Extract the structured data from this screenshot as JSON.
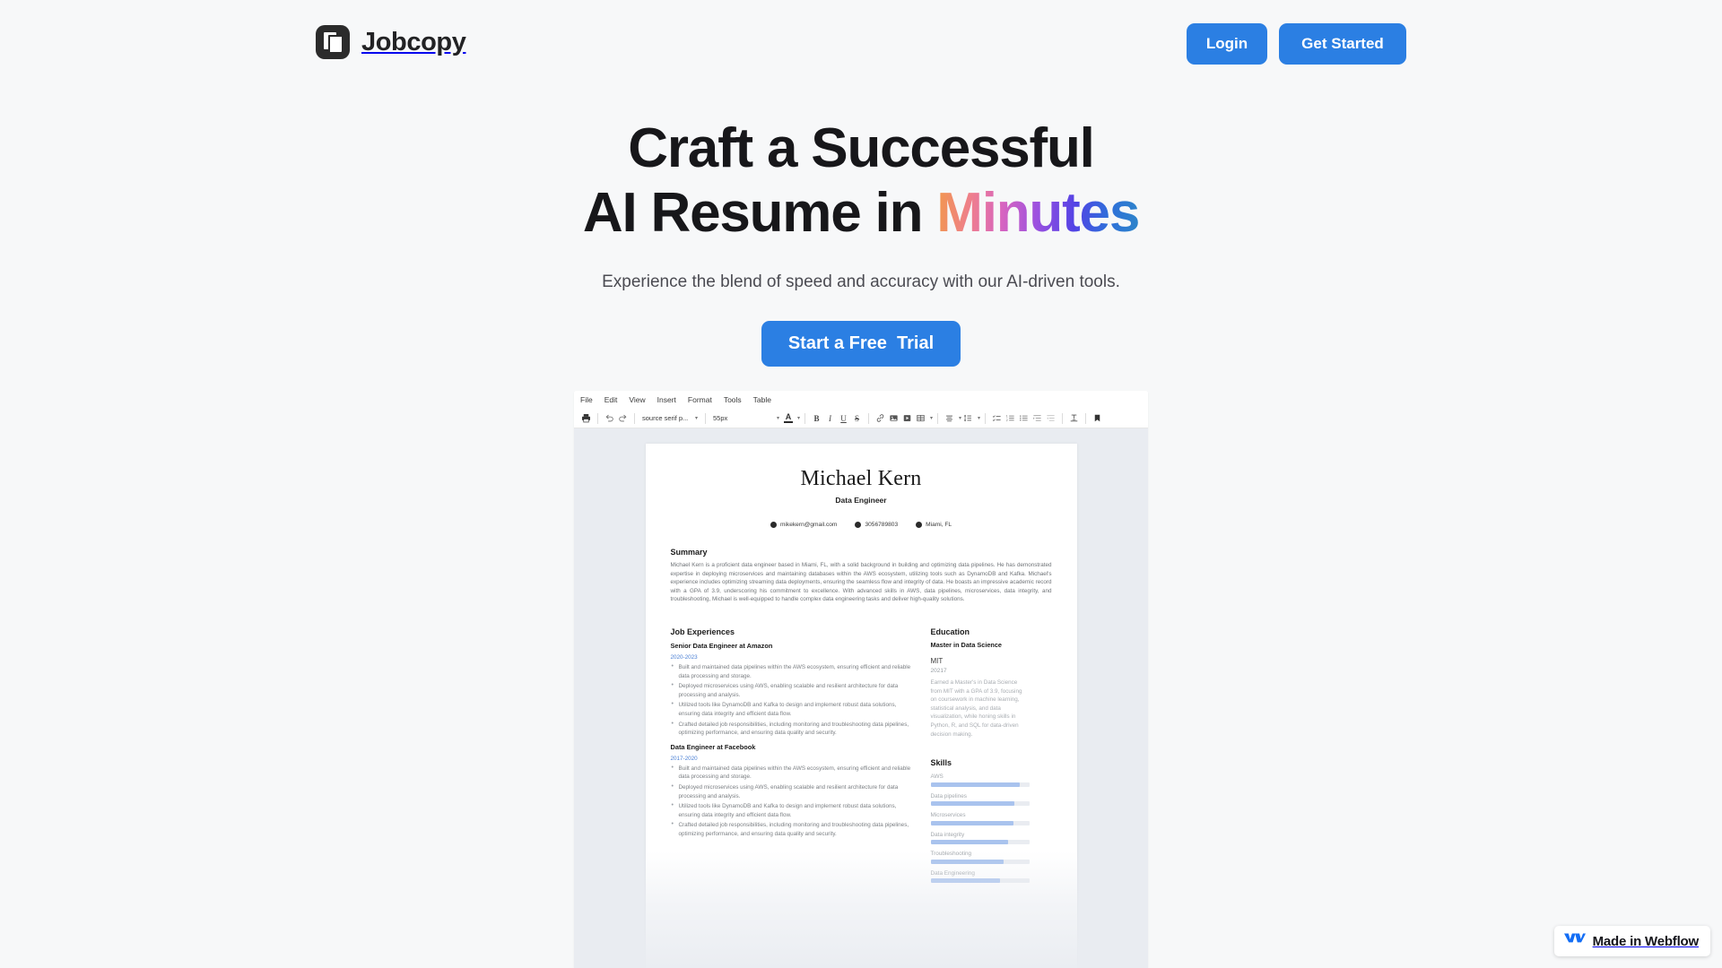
{
  "header": {
    "brand_name": "Jobcopy",
    "login_label": "Login",
    "get_started_label": "Get Started"
  },
  "hero": {
    "headline_line1": "Craft a Successful",
    "headline_line2_prefix": "AI Resume in ",
    "headline_gradient_word": "Minutes",
    "subtitle": "Experience the blend of speed and accuracy with our AI-driven tools.",
    "cta_label": "Start a Free  Trial",
    "gradient_colors": [
      "#F2994A",
      "#EE7E8F",
      "#D764C0",
      "#9B51E0",
      "#5243E5",
      "#2F6FDA",
      "#2D86C9"
    ],
    "accent_color": "#2B7FE3"
  },
  "editor": {
    "menu": [
      "File",
      "Edit",
      "View",
      "Insert",
      "Format",
      "Tools",
      "Table"
    ],
    "toolbar": {
      "print": "print-icon",
      "undo": "undo-icon",
      "redo": "redo-icon",
      "font_family_value": "source serif p...",
      "font_size_value": "55px",
      "text_color": "A",
      "bold": "B",
      "italic": "I",
      "underline": "U",
      "strikethrough": "S",
      "link": "link-icon",
      "image": "image-icon",
      "video": "video-icon",
      "table": "table-icon",
      "align": "align-icon",
      "line_height": "line-height-icon",
      "checklist": "checklist-icon",
      "bullet_list": "bullet-list-icon",
      "numbered_list": "numbered-list-icon",
      "indent_increase": "indent-increase-icon",
      "indent_decrease": "indent-decrease-icon",
      "clear_format": "clear-format-icon",
      "bookmark": "bookmark-icon"
    }
  },
  "resume": {
    "name": "Michael Kern",
    "role": "Data Engineer",
    "contacts": [
      {
        "icon": "email-icon",
        "value": "mikekern@gmail.com"
      },
      {
        "icon": "phone-icon",
        "value": "3056789803"
      },
      {
        "icon": "location-icon",
        "value": "Miami, FL"
      }
    ],
    "summary_title": "Summary",
    "summary_text": "Michael Kern is a proficient data engineer based in Miami, FL, with a solid background in building and optimizing data pipelines. He has demonstrated expertise in deploying microservices and maintaining databases within the AWS ecosystem, utilizing tools such as DynamoDB and Kafka. Michael's experience includes optimizing streaming data deployments, ensuring the seamless flow and integrity of data. He boasts an impressive academic record with a GPA of 3.9, underscoring his commitment to excellence. With advanced skills in AWS, data pipelines, microservices, data integrity, and troubleshooting, Michael is well-equipped to handle complex data engineering tasks and deliver high-quality solutions.",
    "jobs_title": "Job Experiences",
    "jobs": [
      {
        "title": "Senior Data Engineer at Amazon",
        "dates": "2020-2023",
        "bullets": [
          "Built and maintained data pipelines within the AWS ecosystem, ensuring efficient and reliable data processing and storage.",
          "Deployed microservices using AWS, enabling scalable and resilient architecture for data processing and analysis.",
          "Utilized tools like DynamoDB and Kafka to design and implement robust data solutions, ensuring data integrity and efficient data flow.",
          "Crafted detailed job responsibilities, including monitoring and troubleshooting data pipelines, optimizing performance, and ensuring data quality and security."
        ]
      },
      {
        "title": "Data Engineer at Facebook",
        "dates": "2017-2020",
        "bullets": [
          "Built and maintained data pipelines within the AWS ecosystem, ensuring efficient and reliable data processing and storage.",
          "Deployed microservices using AWS, enabling scalable and resilient architecture for data processing and analysis.",
          "Utilized tools like DynamoDB and Kafka to design and implement robust data solutions, ensuring data integrity and efficient data flow.",
          "Crafted detailed job responsibilities, including monitoring and troubleshooting data pipelines, optimizing performance, and ensuring data quality and security."
        ]
      }
    ],
    "education_title": "Education",
    "education": {
      "degree": "Master in Data Science",
      "school": "MIT",
      "year": "20217",
      "description": "Earned a Master's in Data Science from MIT with a GPA of 3.9, focusing on coursework in machine learning, statistical analysis, and data visualization, while honing skills in Python, R, and SQL for data-driven decision making."
    },
    "skills_title": "Skills",
    "skills": [
      {
        "name": "AWS",
        "level": 90
      },
      {
        "name": "Data pipelines",
        "level": 85
      },
      {
        "name": "Microservices",
        "level": 84
      },
      {
        "name": "Data integrity",
        "level": 79
      },
      {
        "name": "Troubleshooting",
        "level": 74
      },
      {
        "name": "Data Engineering",
        "level": 70
      }
    ]
  },
  "badge": {
    "label": "Made in Webflow",
    "logo": "webflow-logo-icon"
  }
}
